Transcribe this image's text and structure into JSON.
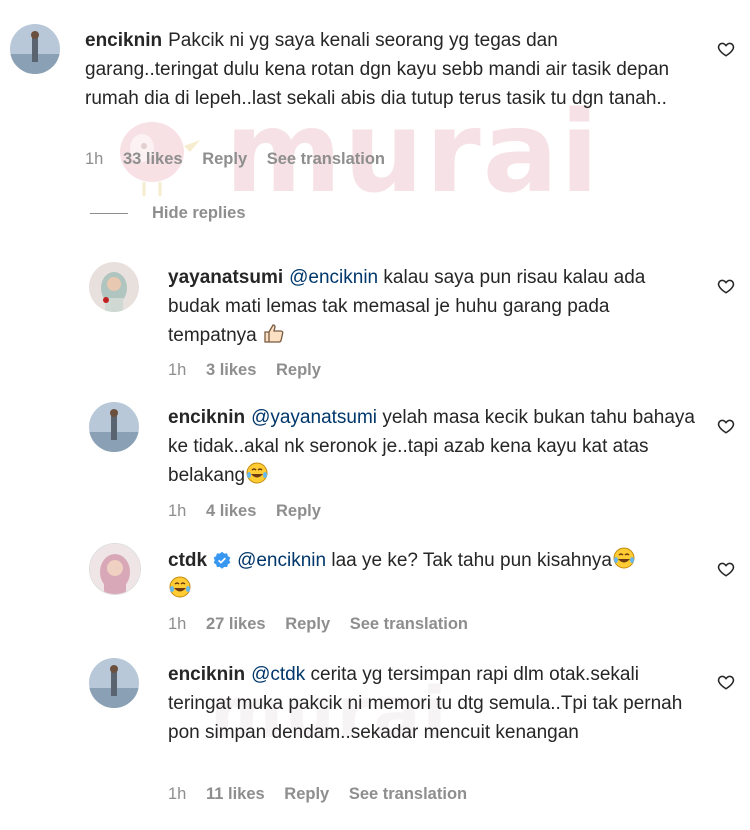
{
  "watermark": {
    "text": "murai"
  },
  "comments": [
    {
      "username": "enciknin",
      "mention": "",
      "text": "Pakcik ni yg saya kenali seorang yg tegas dan garang..teringat dulu kena rotan dgn kayu sebb mandi air tasik depan rumah dia di lepeh..last sekali abis dia tutup terus tasik tu dgn tanah..",
      "time": "1h",
      "likes": "33 likes",
      "reply": "Reply",
      "translation": "See translation",
      "verified": false
    },
    {
      "username": "yayanatsumi",
      "mention": "@enciknin",
      "text": "kalau saya pun risau kalau ada budak mati lemas tak memasal je huhu garang pada tempatnya",
      "time": "1h",
      "likes": "3 likes",
      "reply": "Reply",
      "verified": false
    },
    {
      "username": "enciknin",
      "mention": "@yayanatsumi",
      "text": "yelah masa kecik bukan tahu bahaya ke tidak..akal nk seronok je..tapi azab kena kayu kat atas belakang",
      "time": "1h",
      "likes": "4 likes",
      "reply": "Reply",
      "verified": false
    },
    {
      "username": "ctdk",
      "mention": "@enciknin",
      "text": "laa ye ke? Tak tahu pun kisahnya",
      "time": "1h",
      "likes": "27 likes",
      "reply": "Reply",
      "translation": "See translation",
      "verified": true
    },
    {
      "username": "enciknin",
      "mention": "@ctdk",
      "text": "cerita yg tersimpan rapi dlm otak.sekali teringat muka pakcik ni memori tu dtg semula..Tpi tak pernah pon simpan dendam..sekadar mencuit kenangan",
      "time": "1h",
      "likes": "11 likes",
      "reply": "Reply",
      "translation": "See translation",
      "verified": false
    }
  ],
  "hide_replies": "Hide replies",
  "colors": {
    "verified": "#3897f0",
    "mention": "#00376b",
    "meta": "#8e8e8e"
  },
  "icons": [
    "heart-outline-icon",
    "verified-badge-icon",
    "thumbs-up-emoji",
    "tears-of-joy-emoji"
  ]
}
